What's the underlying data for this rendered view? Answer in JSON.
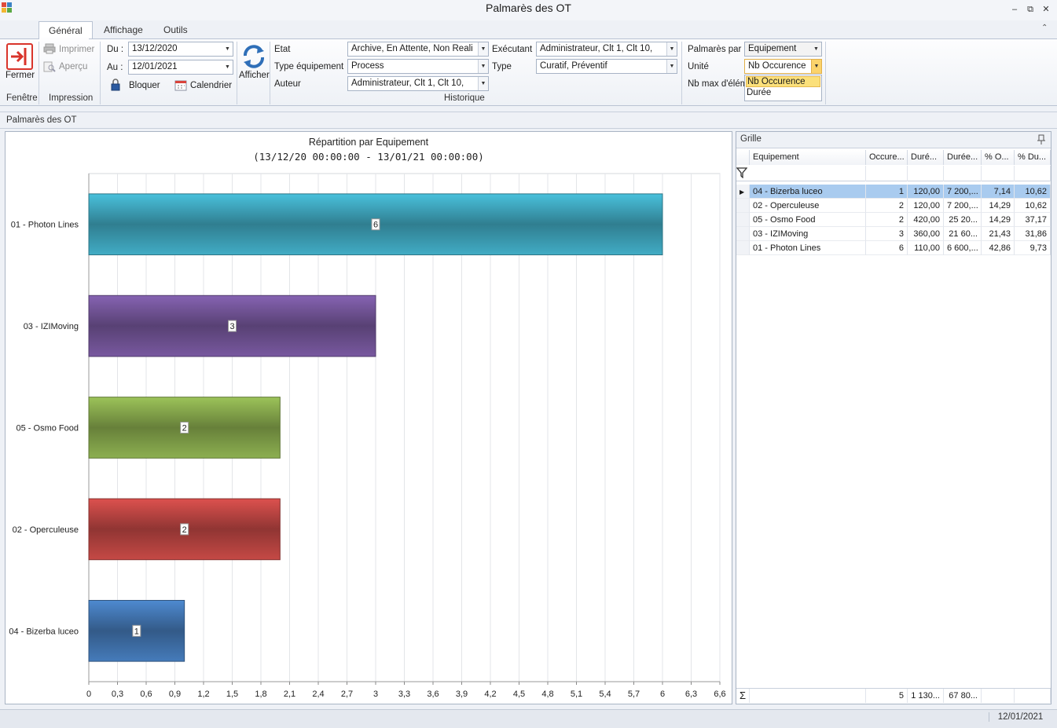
{
  "window": {
    "title": "Palmarès des OT",
    "minimize": "‒",
    "restore": "⧉",
    "close": "✕"
  },
  "tabs": [
    {
      "label": "Général",
      "active": true
    },
    {
      "label": "Affichage",
      "active": false
    },
    {
      "label": "Outils",
      "active": false
    }
  ],
  "ribbon": {
    "fenetre": {
      "close_label": "Fermer",
      "caption": "Fenêtre"
    },
    "impression": {
      "print_label": "Imprimer",
      "preview_label": "Aperçu",
      "caption": "Impression"
    },
    "period": {
      "du_label": "Du :",
      "du_value": "13/12/2020",
      "au_label": "Au :",
      "au_value": "12/01/2021",
      "lock_label": "Bloquer",
      "calendar_label": "Calendrier"
    },
    "afficher_label": "Afficher",
    "historique": {
      "caption": "Historique",
      "etat_label": "Etat",
      "etat_value": "Archive,   En Attente,   Non Reali",
      "type_equip_label": "Type équipement",
      "type_equip_value": "Process",
      "auteur_label": "Auteur",
      "auteur_value": "Administrateur,   Clt 1,   Clt 10,",
      "executant_label": "Exécutant",
      "executant_value": "Administrateur,   Clt 1,   Clt 10,",
      "type_label": "Type",
      "type_value": "Curatif,   Préventif"
    },
    "palmares": {
      "par_label": "Palmarès par",
      "par_value": "Equipement",
      "unite_label": "Unité",
      "unite_value": "Nb Occurence",
      "nbmax_label": "Nb max d'élém",
      "dropdown_options": [
        "Nb Occurence",
        "Durée"
      ]
    }
  },
  "panel_caption": "Palmarès des OT",
  "chart_data": {
    "type": "bar",
    "orientation": "horizontal",
    "title": "Répartition par Equipement",
    "subtitle": "(13/12/20 00:00:00 - 13/01/21 00:00:00)",
    "categories": [
      "01 - Photon Lines",
      "03 - IZIMoving",
      "05 - Osmo Food",
      "02 - Operculeuse",
      "04 - Bizerba luceo"
    ],
    "values": [
      6,
      3,
      2,
      2,
      1
    ],
    "colors": [
      "#3a9ab0",
      "#6b4f8e",
      "#7d9c47",
      "#b0413e",
      "#3e6ea6"
    ],
    "xlim": [
      0,
      6.6
    ],
    "xticks": [
      "0",
      "0,3",
      "0,6",
      "0,9",
      "1,2",
      "1,5",
      "1,8",
      "2,1",
      "2,4",
      "2,7",
      "3",
      "3,3",
      "3,6",
      "3,9",
      "4,2",
      "4,5",
      "4,8",
      "5,1",
      "5,4",
      "5,7",
      "6",
      "6,3",
      "6,6"
    ],
    "grid": true,
    "legend": "none"
  },
  "grid": {
    "caption": "Grille",
    "columns": [
      "Equipement",
      "Occure...",
      "Duré...",
      "Durée...",
      "% O...",
      "% Du..."
    ],
    "rows": [
      [
        "04 - Bizerba luceo",
        "1",
        "120,00",
        "7 200,...",
        "7,14",
        "10,62"
      ],
      [
        "02 - Operculeuse",
        "2",
        "120,00",
        "7 200,...",
        "14,29",
        "10,62"
      ],
      [
        "05 - Osmo Food",
        "2",
        "420,00",
        "25 20...",
        "14,29",
        "37,17"
      ],
      [
        "03 - IZIMoving",
        "3",
        "360,00",
        "21 60...",
        "21,43",
        "31,86"
      ],
      [
        "01 - Photon Lines",
        "6",
        "110,00",
        "6 600,...",
        "42,86",
        "9,73"
      ]
    ],
    "footer": [
      "",
      "5",
      "1 130...",
      "67 80...",
      "",
      ""
    ]
  },
  "status": {
    "date": "12/01/2021"
  }
}
